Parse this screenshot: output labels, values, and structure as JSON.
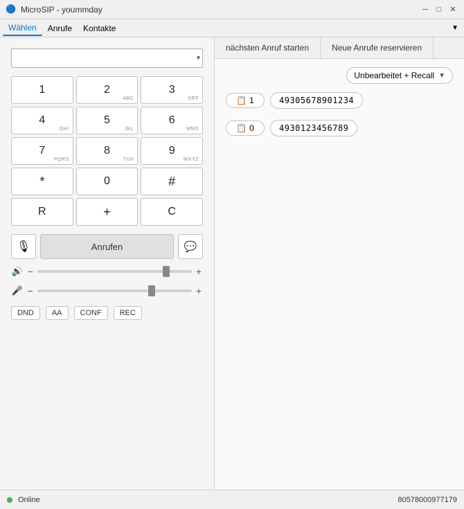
{
  "titleBar": {
    "icon": "🔵",
    "title": "MicroSIP - yoummday",
    "minimizeLabel": "─",
    "restoreLabel": "□",
    "closeLabel": "✕"
  },
  "menuBar": {
    "items": [
      {
        "label": "Wählen",
        "active": true
      },
      {
        "label": "Anrufe",
        "active": false
      },
      {
        "label": "Kontakte",
        "active": false
      }
    ],
    "dropdownIcon": "▼"
  },
  "dialer": {
    "numberInputPlaceholder": "",
    "dropdownIcon": "▾",
    "keys": [
      {
        "main": "1",
        "sub": ""
      },
      {
        "main": "2",
        "sub": "ABC"
      },
      {
        "main": "3",
        "sub": "DEF"
      },
      {
        "main": "4",
        "sub": "GHI"
      },
      {
        "main": "5",
        "sub": "JKL"
      },
      {
        "main": "6",
        "sub": "MNO"
      },
      {
        "main": "7",
        "sub": "PQRS"
      },
      {
        "main": "8",
        "sub": "TUV"
      },
      {
        "main": "9",
        "sub": "WXYZ"
      },
      {
        "main": "*",
        "sub": ""
      },
      {
        "main": "0",
        "sub": ""
      },
      {
        "main": "#",
        "sub": ""
      },
      {
        "main": "R",
        "sub": ""
      },
      {
        "main": "+",
        "sub": ""
      },
      {
        "main": "C",
        "sub": ""
      }
    ],
    "callButton": "Anrufen",
    "volumeSlider1Value": 85,
    "volumeSlider2Value": 75,
    "featureButtons": [
      "DND",
      "AA",
      "CONF",
      "REC"
    ]
  },
  "rightPanel": {
    "tabs": [
      {
        "label": "nächsten Anruf starten",
        "active": false
      },
      {
        "label": "Neue Anrufe reservieren",
        "active": false
      }
    ],
    "statusDropdown": {
      "label": "Unbearbeitet + Recall",
      "arrow": "▼"
    },
    "callEntries": [
      {
        "icon": "📋",
        "count": "1",
        "number": "49305678901234"
      },
      {
        "icon": "📋",
        "count": "0",
        "number": "4930123456789"
      }
    ]
  },
  "statusBar": {
    "statusLabel": "Online",
    "statusColor": "#4CAF50",
    "phoneNumber": "80578000977179"
  }
}
